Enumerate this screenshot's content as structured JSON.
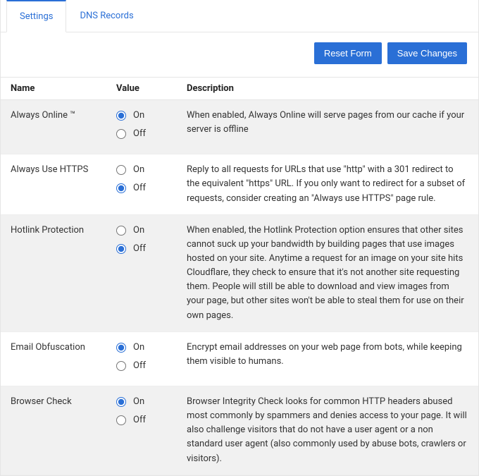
{
  "tabs": {
    "settings": "Settings",
    "dns": "DNS Records"
  },
  "buttons": {
    "reset": "Reset Form",
    "save": "Save Changes"
  },
  "headers": {
    "name": "Name",
    "value": "Value",
    "description": "Description"
  },
  "option_labels": {
    "on": "On",
    "off": "Off"
  },
  "rows": [
    {
      "id": "always-online",
      "name": "Always Online ™",
      "selected": "on",
      "description": "When enabled, Always Online will serve pages from our cache if your server is offline"
    },
    {
      "id": "always-use-https",
      "name": "Always Use HTTPS",
      "selected": "off",
      "description": "Reply to all requests for URLs that use \"http\" with a 301 redirect to the equivalent \"https\" URL. If you only want to redirect for a subset of requests, consider creating an \"Always use HTTPS\" page rule."
    },
    {
      "id": "hotlink-protection",
      "name": "Hotlink Protection",
      "selected": "off",
      "description": "When enabled, the Hotlink Protection option ensures that other sites cannot suck up your bandwidth by building pages that use images hosted on your site. Anytime a request for an image on your site hits Cloudflare, they check to ensure that it's not another site requesting them. People will still be able to download and view images from your page, but other sites won't be able to steal them for use on their own pages."
    },
    {
      "id": "email-obfuscation",
      "name": "Email Obfuscation",
      "selected": "on",
      "description": "Encrypt email addresses on your web page from bots, while keeping them visible to humans."
    },
    {
      "id": "browser-check",
      "name": "Browser Check",
      "selected": "on",
      "description": "Browser Integrity Check looks for common HTTP headers abused most commonly by spammers and denies access to your page. It will also challenge visitors that do not have a user agent or a non standard user agent (also commonly used by abuse bots, crawlers or visitors)."
    }
  ]
}
